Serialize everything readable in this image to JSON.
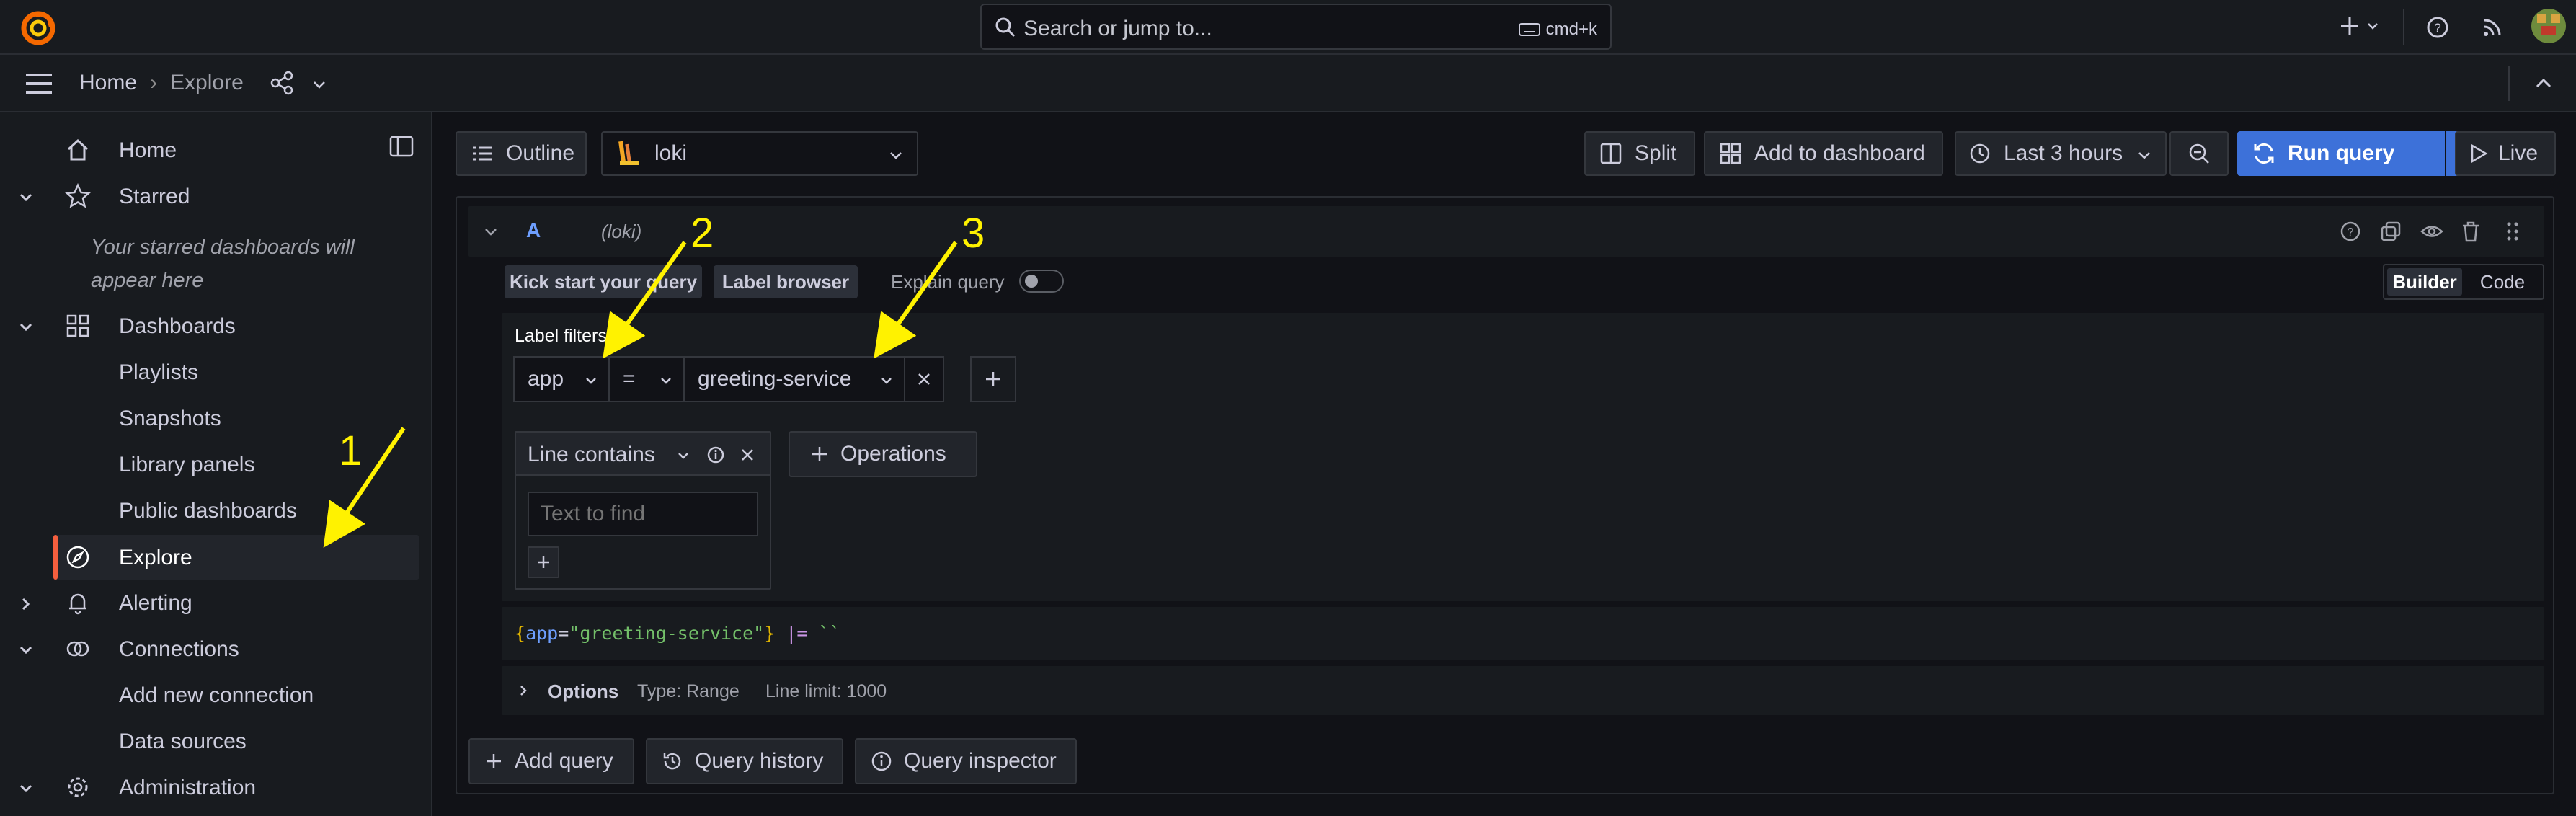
{
  "topbar": {
    "search_placeholder": "Search or jump to...",
    "search_shortcut": "cmd+k"
  },
  "breadcrumb": {
    "home": "Home",
    "separator": "›",
    "current": "Explore"
  },
  "sidebar": {
    "items": [
      {
        "label": "Home"
      },
      {
        "label": "Starred"
      },
      {
        "label": "Your starred dashboards will appear here"
      },
      {
        "label": "Dashboards"
      },
      {
        "label": "Playlists"
      },
      {
        "label": "Snapshots"
      },
      {
        "label": "Library panels"
      },
      {
        "label": "Public dashboards"
      },
      {
        "label": "Explore"
      },
      {
        "label": "Alerting"
      },
      {
        "label": "Connections"
      },
      {
        "label": "Add new connection"
      },
      {
        "label": "Data sources"
      },
      {
        "label": "Administration"
      }
    ],
    "starred_empty_line1": "Your starred dashboards will",
    "starred_empty_line2": "appear here"
  },
  "toolbar": {
    "outline": "Outline",
    "datasource": "loki",
    "split": "Split",
    "add_to_dashboard": "Add to dashboard",
    "time_range": "Last 3 hours",
    "run_query": "Run query",
    "live": "Live"
  },
  "query": {
    "ref_id": "A",
    "datasource_tag": "(loki)",
    "kick_start": "Kick start your query",
    "label_browser": "Label browser",
    "explain_query": "Explain query",
    "mode_builder": "Builder",
    "mode_code": "Code",
    "label_filters_title": "Label filters",
    "label_key": "app",
    "operator": "=",
    "label_value": "greeting-service",
    "line_contains": "Line contains",
    "text_to_find_placeholder": "Text to find",
    "operations": "Operations",
    "code_brace_open": "{",
    "code_key": "app",
    "code_eq": "=",
    "code_value": "\"greeting-service\"",
    "code_brace_close": "}",
    "code_op": "|=",
    "code_tail": "``",
    "options_label": "Options",
    "options_type": "Type: Range",
    "options_limit": "Line limit: 1000"
  },
  "bottom_actions": {
    "add_query": "Add query",
    "query_history": "Query history",
    "query_inspector": "Query inspector"
  },
  "annotations": {
    "n1": "1",
    "n2": "2",
    "n3": "3"
  },
  "colors": {
    "accent": "#3d71d9",
    "active_indicator": "#f55f3e",
    "annotation": "#fff200",
    "background": "#111217",
    "panel": "#181b1f"
  }
}
